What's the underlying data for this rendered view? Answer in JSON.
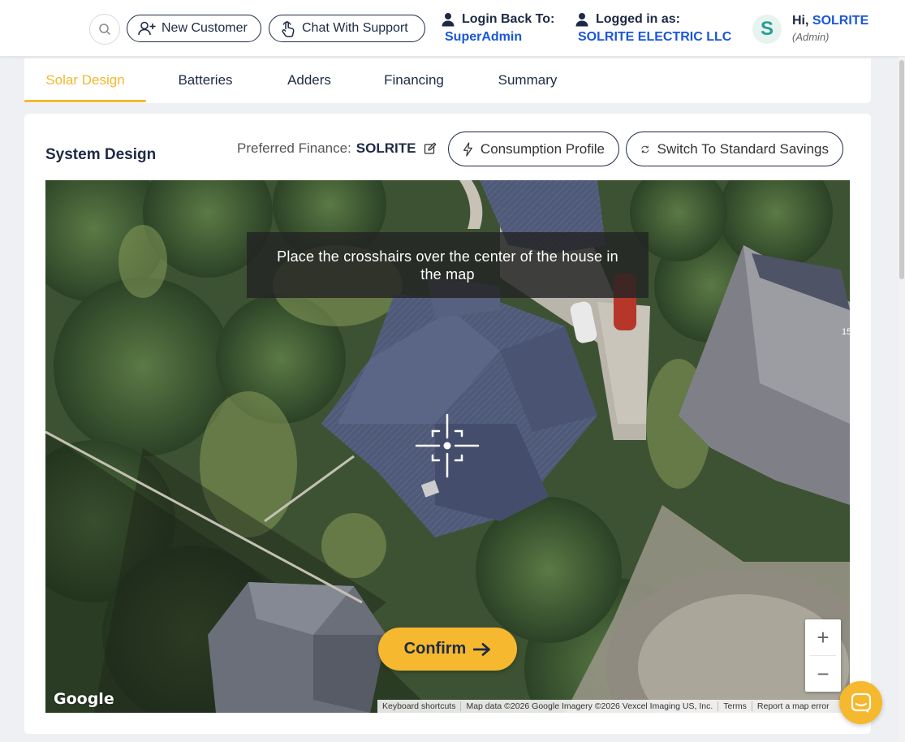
{
  "header": {
    "search_icon": "search-icon",
    "new_customer_label": "New Customer",
    "chat_support_label": "Chat With Support",
    "login_back_label": "Login Back To:",
    "login_back_value": "SuperAdmin",
    "logged_in_label": "Logged in as:",
    "logged_in_value": "SOLRITE ELECTRIC LLC",
    "avatar_letter": "S",
    "greeting_prefix": "Hi,",
    "greeting_name": "SOLRITE",
    "role": "(Admin)"
  },
  "tabs": [
    {
      "label": "Solar Design",
      "active": true
    },
    {
      "label": "Batteries",
      "active": false
    },
    {
      "label": "Adders",
      "active": false
    },
    {
      "label": "Financing",
      "active": false
    },
    {
      "label": "Summary",
      "active": false
    }
  ],
  "system_design": {
    "title": "System Design",
    "preferred_finance_label": "Preferred Finance:",
    "preferred_finance_value": "SOLRITE",
    "consumption_profile_label": "Consumption Profile",
    "switch_savings_label": "Switch To Standard Savings"
  },
  "map": {
    "hint": "Place the crosshairs over the center of the house in the map",
    "confirm_label": "Confirm",
    "zoom_in": "+",
    "zoom_out": "−",
    "logo_text": "Google",
    "house_number": "15",
    "attribution": {
      "keyboard": "Keyboard shortcuts",
      "map_data": "Map data ©2026 Google Imagery ©2026 Vexcel Imaging US, Inc.",
      "terms": "Terms",
      "report": "Report a map error"
    }
  },
  "colors": {
    "accent": "#f5b82e",
    "link": "#1a56db",
    "navy": "#1e2a44"
  }
}
